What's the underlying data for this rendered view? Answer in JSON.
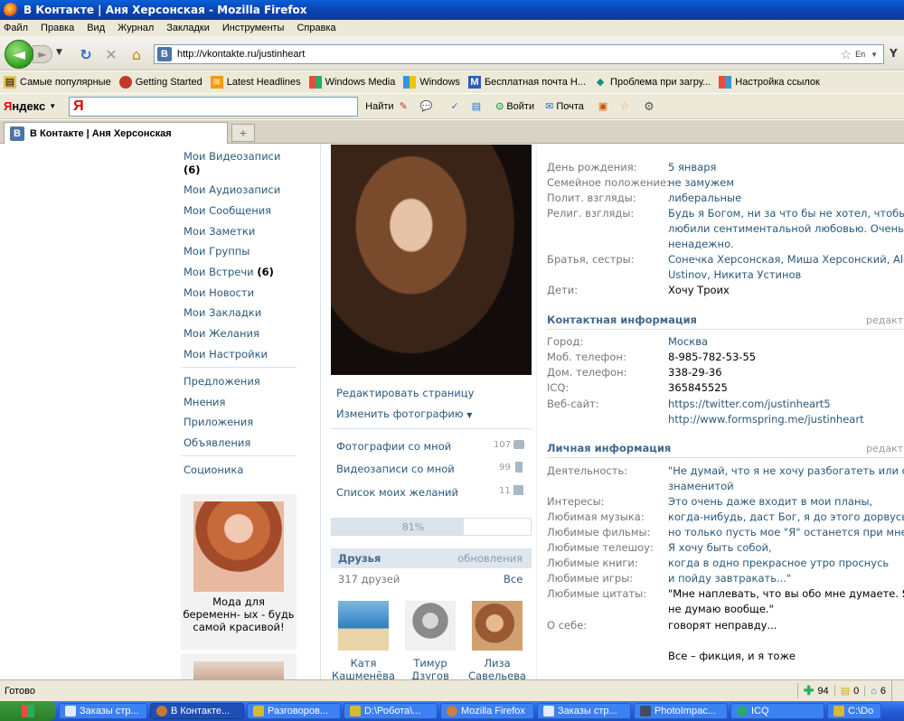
{
  "window": {
    "title": "В Контакте | Аня Херсонская - Mozilla Firefox"
  },
  "menu": [
    "Файл",
    "Правка",
    "Вид",
    "Журнал",
    "Закладки",
    "Инструменты",
    "Справка"
  ],
  "nav": {
    "url": "http://vkontakte.ru/justinheart",
    "lang": "En"
  },
  "bookmarks": [
    "Самые популярные",
    "Getting Started",
    "Latest Headlines",
    "Windows Media",
    "Windows",
    "Бесплатная почта Н...",
    "Проблема при загру...",
    "Настройка ссылок"
  ],
  "yandex": {
    "logo_a": "Я",
    "logo_b": "ндекс",
    "input": "Я",
    "find": "Найти",
    "login": "Войти",
    "mail": "Почта"
  },
  "tab": {
    "title": "В Контакте | Аня Херсонская",
    "new_tab": "+"
  },
  "sidebar": {
    "videos": "Мои Видеозаписи",
    "videos_count": "(6)",
    "items": [
      "Мои Аудиозаписи",
      "Мои Сообщения",
      "Мои Заметки",
      "Мои Группы"
    ],
    "meetings": "Мои Встречи",
    "meetings_count": "(6)",
    "items2": [
      "Мои Новости",
      "Мои Закладки",
      "Мои Желания",
      "Мои Настройки"
    ],
    "items3": [
      "Предложения",
      "Мнения",
      "Приложения",
      "Объявления"
    ],
    "socionics": "Соционика",
    "ad_text": "Мода для беременн- ых - будь самой красивой!"
  },
  "profile": {
    "edit_page": "Редактировать страницу",
    "change_photo": "Изменить фотографию",
    "links": [
      {
        "label": "Фотографии со мной",
        "count": "107"
      },
      {
        "label": "Видеозаписи со мной",
        "count": "99"
      },
      {
        "label": "Список моих желаний",
        "count": "11"
      }
    ],
    "progress": 81,
    "progress_label": "81%",
    "friends_title": "Друзья",
    "friends_updates": "обновления",
    "friends_count": "317 друзей",
    "friends_all": "Все",
    "friends": [
      {
        "first": "Катя",
        "last": "Кашменёва"
      },
      {
        "first": "Тимур",
        "last": "Дзугов"
      },
      {
        "first": "Лиза",
        "last": "Савельева"
      }
    ]
  },
  "info": {
    "basic": [
      {
        "label": "День рождения:",
        "value": "5 января"
      },
      {
        "label": "Семейное положение:",
        "value": "не замужем"
      },
      {
        "label": "Полит. взгляды:",
        "value": "либеральные"
      },
      {
        "label": "Религ. взгляды:",
        "lines": [
          "Будь я Богом, ни за что бы не хотел, чтобы м",
          "любили сентиментальной любовью. Очень уж",
          "ненадежно."
        ]
      },
      {
        "label": "Братья, сестры:",
        "lines": [
          "Сонечка Херсонская, Миша Херсонский, Alex",
          "Ustinov, Никита Устинов"
        ]
      },
      {
        "label": "Дети:",
        "value": "Хочу Троих"
      }
    ],
    "contact_title": "Контактная информация",
    "edit": "редакт",
    "contact": [
      {
        "label": "Город:",
        "value": "Москва"
      },
      {
        "label": "Моб. телефон:",
        "value": "8-985-782-53-55"
      },
      {
        "label": "Дом. телефон:",
        "value": "338-29-36"
      },
      {
        "label": "ICQ:",
        "value": "365845525"
      },
      {
        "label": "Веб-сайт:",
        "lines": [
          "https://twitter.com/justinheart5",
          "http://www.formspring.me/justinheart"
        ]
      }
    ],
    "personal_title": "Личная информация",
    "personal": [
      {
        "label": "Деятельность:",
        "lines": [
          "\"Не думай, что я не хочу разбогатеть или ста",
          "знаменитой"
        ]
      },
      {
        "label": "Интересы:",
        "value": "Это очень даже входит в мои планы,"
      },
      {
        "label": "Любимая музыка:",
        "value": "когда-нибудь, даст Бог, я до этого дорвусь,"
      },
      {
        "label": "Любимые фильмы:",
        "value": "но только пусть мое \"Я\" останется при мне"
      },
      {
        "label": "Любимые телешоу:",
        "value": "Я хочу быть собой,"
      },
      {
        "label": "Любимые книги:",
        "value": "когда в одно прекрасное утро проснусь"
      },
      {
        "label": "Любимые игры:",
        "value": "и пойду завтракать...\""
      },
      {
        "label": "Любимые цитаты:",
        "lines": [
          "\"Мне наплевать, что вы обо мне думаете. Я о",
          "не думаю вообще.\""
        ]
      },
      {
        "label": "О себе:",
        "lines": [
          "говорят неправду...",
          "",
          "Все – фикция, и я тоже"
        ]
      }
    ]
  },
  "status": {
    "text": "Готово",
    "n1": "94",
    "n2": "0",
    "n3": "6"
  },
  "taskbar": [
    {
      "label": "Заказы стр...",
      "active": false
    },
    {
      "label": "В Контакте...",
      "active": true
    },
    {
      "label": "Разговоров...",
      "active": false
    },
    {
      "label": "D:\\Робота\\...",
      "active": false
    },
    {
      "label": "Mozilla Firefox",
      "active": false
    },
    {
      "label": "Заказы стр...",
      "active": false
    },
    {
      "label": "PhotoImpac...",
      "active": false
    },
    {
      "label": "ICQ",
      "active": false
    },
    {
      "label": "C:\\Do",
      "active": false
    }
  ],
  "colors": {
    "vk_link": "#2b587a",
    "vk_header": "#45688e",
    "xp_blue": "#245edb"
  }
}
